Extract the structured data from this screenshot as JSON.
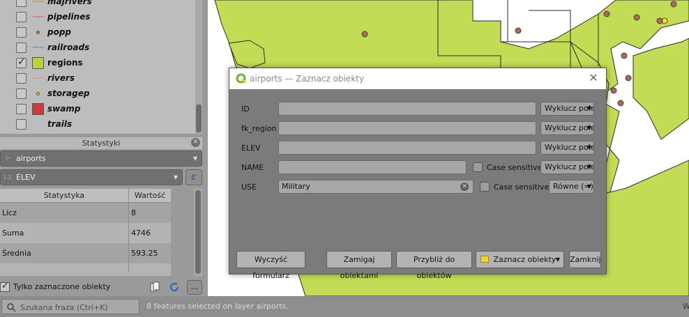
{
  "layers": [
    {
      "name": "majrivers",
      "symbol": "line",
      "color": "#c9a24a",
      "checked": false
    },
    {
      "name": "pipelines",
      "symbol": "line",
      "color": "#c98b8b",
      "checked": false
    },
    {
      "name": "popp",
      "symbol": "dot",
      "color": "#c77a5a",
      "checked": false
    },
    {
      "name": "railroads",
      "symbol": "line",
      "color": "#9a9ab8",
      "checked": false
    },
    {
      "name": "regions",
      "symbol": "square",
      "color": "#b8d43a",
      "checked": true
    },
    {
      "name": "rivers",
      "symbol": "line",
      "color": "#d59bb0",
      "checked": false
    },
    {
      "name": "storagep",
      "symbol": "dot",
      "color": "#e0c040",
      "checked": false
    },
    {
      "name": "swamp",
      "symbol": "square",
      "color": "#d03a3a",
      "checked": false
    },
    {
      "name": "trails",
      "symbol": "none",
      "color": "",
      "checked": false
    }
  ],
  "stats": {
    "title": "Statystyki",
    "layer": "airports",
    "field": "ELEV",
    "field_prefix": "1.2",
    "expr_icon": "ε",
    "col_stat": "Statystyka",
    "col_value": "Wartość",
    "rows": [
      {
        "stat": "Licz",
        "value": "8"
      },
      {
        "stat": "Suma",
        "value": "4746"
      },
      {
        "stat": "Średnia",
        "value": "593.25"
      }
    ],
    "only_selected_label": "Tylko zaznaczone obiekty",
    "more_label": "..."
  },
  "status": {
    "search_placeholder": "Szukana fraza (Ctrl+K)",
    "message": "8 features selected on layer airports.",
    "right_text": "W"
  },
  "dialog": {
    "title": "airports — Zaznacz obiekty",
    "fields": [
      {
        "label": "ID",
        "value": "",
        "operator": "Wyklucz pole"
      },
      {
        "label": "fk_region",
        "value": "",
        "operator": "Wyklucz pole"
      },
      {
        "label": "ELEV",
        "value": "",
        "operator": "Wyklucz pole"
      },
      {
        "label": "NAME",
        "value": "",
        "operator": "Wyklucz pole",
        "case_label": "Case sensitive"
      },
      {
        "label": "USE",
        "value": "Military",
        "operator": "Równe (=)",
        "case_label": "Case sensitive"
      }
    ],
    "buttons": {
      "clear": "Wyczyść formularz",
      "flash": "Zamigaj obiektami",
      "zoom": "Przybliż do obiektów",
      "select": "Zaznacz obiekty",
      "close": "Zamknij"
    }
  },
  "colors": {
    "land": "#c3dc55",
    "land_stroke": "#2a2a2a",
    "point": "#a46b5e"
  }
}
